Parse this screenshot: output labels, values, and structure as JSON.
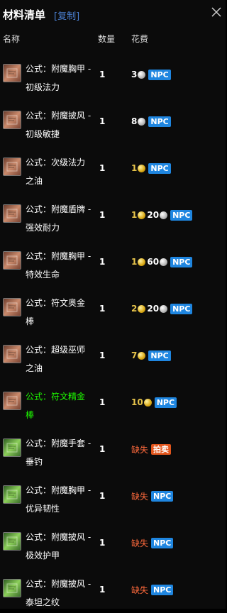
{
  "header": {
    "title": "材料清单",
    "copy_label": "[复制]"
  },
  "columns": {
    "name": "名称",
    "qty": "数量",
    "cost": "花费"
  },
  "colors": {
    "gold": "#e6c34a",
    "npc": "#1f86e0",
    "auction": "#e2551c",
    "missing": "#ff6a3c",
    "uncommon": "#1eff00",
    "link": "#4a7fd0"
  },
  "rows": [
    {
      "icon": "brown-recipe-icon",
      "line1": "公式：附魔胸甲 -",
      "line2": "初级法力",
      "qty": "1",
      "gold": "",
      "silver": "3",
      "missing": "",
      "badge": "NPC",
      "badge_type": "npc",
      "green": false
    },
    {
      "icon": "brown-recipe-icon",
      "line1": "公式：附魔披风 -",
      "line2": "初级敏捷",
      "qty": "1",
      "gold": "",
      "silver": "8",
      "missing": "",
      "badge": "NPC",
      "badge_type": "npc",
      "green": false
    },
    {
      "icon": "brown-recipe-icon",
      "line1": "公式：次级法力",
      "line2": "之油",
      "qty": "1",
      "gold": "1",
      "silver": "",
      "missing": "",
      "badge": "NPC",
      "badge_type": "npc",
      "green": false
    },
    {
      "icon": "brown-recipe-icon",
      "line1": "公式：附魔盾牌 -",
      "line2": "强效耐力",
      "qty": "1",
      "gold": "1",
      "silver": "20",
      "missing": "",
      "badge": "NPC",
      "badge_type": "npc",
      "green": false
    },
    {
      "icon": "brown-recipe-icon",
      "line1": "公式：附魔胸甲 -",
      "line2": "特效生命",
      "qty": "1",
      "gold": "1",
      "silver": "60",
      "missing": "",
      "badge": "NPC",
      "badge_type": "npc",
      "green": false
    },
    {
      "icon": "brown-recipe-icon",
      "line1": "公式：符文奥金",
      "line2": "棒",
      "qty": "1",
      "gold": "2",
      "silver": "20",
      "missing": "",
      "badge": "NPC",
      "badge_type": "npc",
      "green": false
    },
    {
      "icon": "brown-recipe-icon",
      "line1": "公式：超级巫师",
      "line2": "之油",
      "qty": "1",
      "gold": "7",
      "silver": "",
      "missing": "",
      "badge": "NPC",
      "badge_type": "npc",
      "green": false
    },
    {
      "icon": "brown-recipe-icon",
      "line1": "公式：符文精金",
      "line2": "棒",
      "qty": "1",
      "gold": "10",
      "silver": "",
      "missing": "",
      "badge": "NPC",
      "badge_type": "npc",
      "green": true
    },
    {
      "icon": "green-recipe-icon",
      "line1": "公式：附魔手套 -",
      "line2": "垂钓",
      "qty": "1",
      "gold": "",
      "silver": "",
      "missing": "缺失",
      "badge": "拍卖",
      "badge_type": "auc",
      "green": false
    },
    {
      "icon": "green-recipe-icon",
      "line1": "公式：附魔胸甲 -",
      "line2": "优异韧性",
      "qty": "1",
      "gold": "",
      "silver": "",
      "missing": "缺失",
      "badge": "NPC",
      "badge_type": "npc",
      "green": false
    },
    {
      "icon": "green-recipe-icon",
      "line1": "公式：附魔披风 -",
      "line2": "极效护甲",
      "qty": "1",
      "gold": "",
      "silver": "",
      "missing": "缺失",
      "badge": "NPC",
      "badge_type": "npc",
      "green": false
    },
    {
      "icon": "green-recipe-icon",
      "line1": "公式：附魔披风 -",
      "line2": "泰坦之纹",
      "qty": "1",
      "gold": "",
      "silver": "",
      "missing": "缺失",
      "badge": "NPC",
      "badge_type": "npc",
      "green": false
    }
  ]
}
